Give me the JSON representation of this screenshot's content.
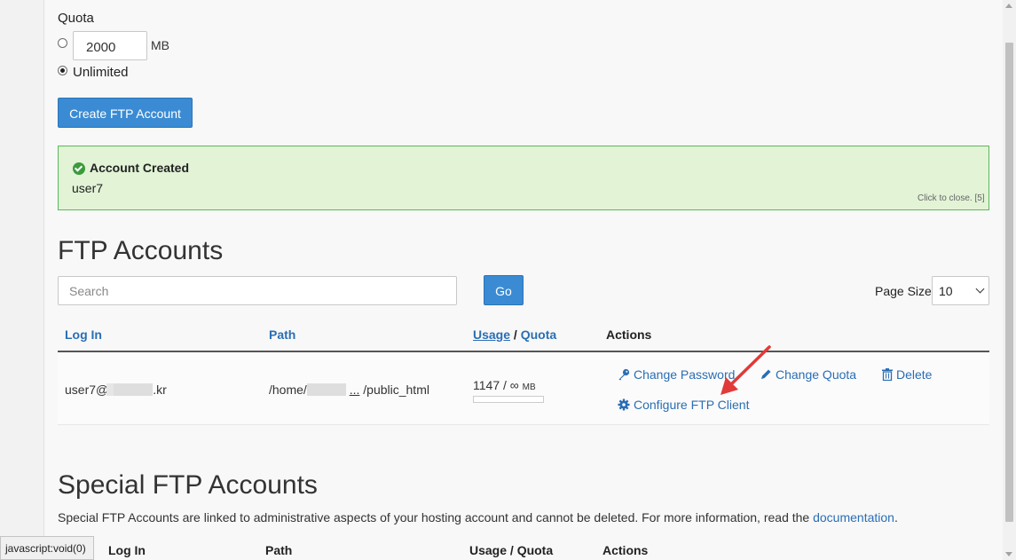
{
  "quota": {
    "label": "Quota",
    "value": "2000",
    "unit": "MB",
    "unlimited_label": "Unlimited"
  },
  "create_button": "Create FTP Account",
  "alert": {
    "title": "Account Created",
    "body": "user7",
    "close_text": "Click to close. [5]"
  },
  "ftp_accounts": {
    "title": "FTP Accounts",
    "search_placeholder": "Search",
    "go_label": "Go",
    "page_size_label": "Page Size",
    "page_size_value": "10",
    "columns": {
      "login": "Log In",
      "path": "Path",
      "usage": "Usage",
      "slash": "/",
      "quota": "Quota",
      "actions": "Actions"
    },
    "row": {
      "login_prefix": "user7@",
      "login_suffix": ".kr",
      "path_prefix": "/home/",
      "path_ellipsis": "...",
      "path_suffix": "/public_html",
      "usage_value": "1147 / ∞",
      "usage_unit": "MB",
      "usage_fraction": 0,
      "actions": {
        "change_password": "Change Password",
        "change_quota": "Change Quota",
        "delete": "Delete",
        "configure": "Configure FTP Client"
      }
    }
  },
  "special": {
    "title": "Special FTP Accounts",
    "description": "Special FTP Accounts are linked to administrative aspects of your hosting account and cannot be deleted. For more information, read the ",
    "doc_link": "documentation",
    "period": ".",
    "columns": {
      "login": "Log In",
      "path": "Path",
      "usage_quota": "Usage / Quota",
      "actions": "Actions"
    }
  },
  "status_bar": "javascript:void(0)",
  "colors": {
    "accent": "#3a8bd3",
    "link": "#2a6eb4",
    "success_bg": "#e2f3d6",
    "annotation_arrow": "#e03a3a"
  }
}
